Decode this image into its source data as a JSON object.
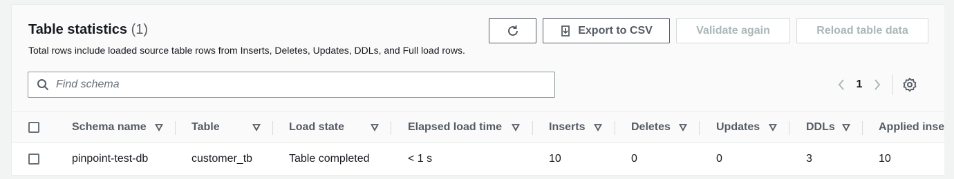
{
  "header": {
    "title": "Table statistics",
    "count": "(1)",
    "description": "Total rows include loaded source table rows from Inserts, Deletes, Updates, DDLs, and Full load rows."
  },
  "actions": {
    "refresh_icon": "refresh-icon",
    "export_label": "Export to CSV",
    "validate_label": "Validate again",
    "reload_label": "Reload table data"
  },
  "search": {
    "placeholder": "Find schema",
    "value": ""
  },
  "pagination": {
    "current_page": "1"
  },
  "table": {
    "columns": [
      "Schema name",
      "Table",
      "Load state",
      "Elapsed load time",
      "Inserts",
      "Deletes",
      "Updates",
      "DDLs",
      "Applied inse"
    ],
    "rows": [
      [
        "pinpoint-test-db",
        "customer_tb",
        "Table completed",
        "< 1 s",
        "10",
        "0",
        "0",
        "3",
        "10"
      ]
    ]
  },
  "colors": {
    "text": "#16191f",
    "muted": "#545b64",
    "disabled": "#aab7b8",
    "border": "#d5dbdb"
  }
}
